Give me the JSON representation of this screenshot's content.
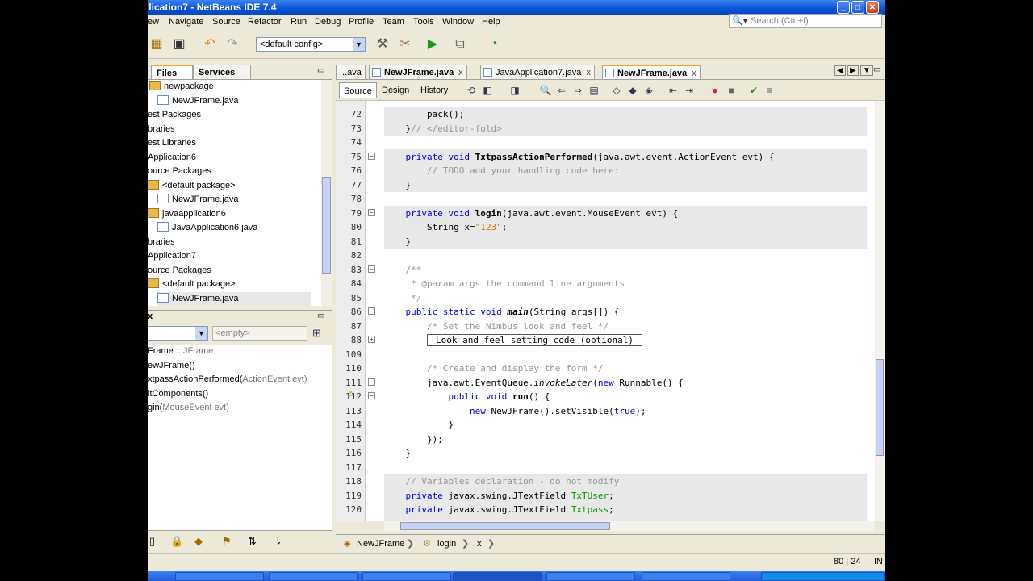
{
  "window": {
    "title": "plication7 - NetBeans IDE 7.4"
  },
  "menu": [
    "ew",
    "Navigate",
    "Source",
    "Refactor",
    "Run",
    "Debug",
    "Profile",
    "Team",
    "Tools",
    "Window",
    "Help"
  ],
  "search": {
    "placeholder": "Search (Ctrl+I)"
  },
  "toolbar": {
    "config": "<default config>"
  },
  "project_tabs": {
    "files": "Files",
    "services": "Services"
  },
  "tree": [
    "newpackage",
    "NewJFrame.java",
    "est Packages",
    "braries",
    "est Libraries",
    "Application6",
    "ource Packages",
    "<default package>",
    "NewJFrame.java",
    "javaapplication6",
    "JavaApplication6.java",
    "braries",
    "Application7",
    "ource Packages",
    "<default package>",
    "NewJFrame.java"
  ],
  "navigator": {
    "filter_value": "<empty>",
    "items": [
      {
        "name": "Frame :: ",
        "type": "JFrame"
      },
      {
        "name": "ewJFrame()",
        "type": ""
      },
      {
        "name": "xtpassActionPerformed(",
        "type": "ActionEvent evt)"
      },
      {
        "name": "itComponents()",
        "type": ""
      },
      {
        "name": "gin(",
        "type": "MouseEvent evt)"
      }
    ]
  },
  "editor_tabs": [
    "...ava",
    "NewJFrame.java",
    "JavaApplication7.java",
    "NewJFrame.java"
  ],
  "editor_views": {
    "source": "Source",
    "design": "Design",
    "history": "History"
  },
  "code": {
    "lines": [
      {
        "n": "72",
        "text": "        pack();"
      },
      {
        "n": "73",
        "text": "    }// </editor-fold>"
      },
      {
        "n": "74",
        "text": ""
      },
      {
        "n": "75",
        "text": "    private void TxtpassActionPerformed(java.awt.event.ActionEvent evt) {"
      },
      {
        "n": "76",
        "text": "        // TODO add your handling code here:"
      },
      {
        "n": "77",
        "text": "    }"
      },
      {
        "n": "78",
        "text": ""
      },
      {
        "n": "79",
        "text": "    private void login(java.awt.event.MouseEvent evt) {"
      },
      {
        "n": "80",
        "text": "        String x=\"123\";"
      },
      {
        "n": "81",
        "text": "    }"
      },
      {
        "n": "82",
        "text": ""
      },
      {
        "n": "83",
        "text": "    /**"
      },
      {
        "n": "84",
        "text": "     * @param args the command line arguments"
      },
      {
        "n": "85",
        "text": "     */"
      },
      {
        "n": "86",
        "text": "    public static void main(String args[]) {"
      },
      {
        "n": "87",
        "text": "        /* Set the Nimbus look and feel */"
      },
      {
        "n": "88",
        "text": "        Look and feel setting code (optional)"
      },
      {
        "n": "109",
        "text": ""
      },
      {
        "n": "110",
        "text": "        /* Create and display the form */"
      },
      {
        "n": "111",
        "text": "        java.awt.EventQueue.invokeLater(new Runnable() {"
      },
      {
        "n": "112",
        "text": "            public void run() {"
      },
      {
        "n": "113",
        "text": "                new NewJFrame().setVisible(true);"
      },
      {
        "n": "114",
        "text": "            }"
      },
      {
        "n": "115",
        "text": "        });"
      },
      {
        "n": "116",
        "text": "    }"
      },
      {
        "n": "117",
        "text": ""
      },
      {
        "n": "118",
        "text": "    // Variables declaration - do not modify"
      },
      {
        "n": "119",
        "text": "    private javax.swing.JTextField TxTUser;"
      },
      {
        "n": "120",
        "text": "    private javax.swing.JTextField Txtpass;"
      }
    ]
  },
  "breadcrumbs": [
    "NewJFrame",
    "login",
    "x"
  ],
  "status": {
    "position": "80 | 24",
    "mode": "IN"
  }
}
